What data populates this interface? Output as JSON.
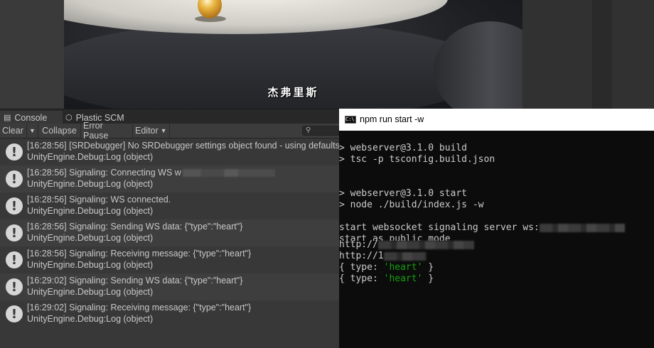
{
  "game_view": {
    "subtitle": "杰弗里斯"
  },
  "console": {
    "tabs": [
      {
        "label": "Console",
        "icon": "console-icon"
      },
      {
        "label": "Plastic SCM",
        "icon": "plastic-scm-icon"
      }
    ],
    "toolbar": {
      "clear_label": "Clear",
      "collapse_label": "Collapse",
      "error_pause_label": "Error Pause",
      "editor_label": "Editor"
    },
    "search": {
      "placeholder": ""
    },
    "logs": [
      {
        "message": "[16:28:56] [SRDebugger] No SRDebugger settings object found - using defaults",
        "source": "UnityEngine.Debug:Log (object)",
        "icon": "warning-icon"
      },
      {
        "message": "[16:28:56] Signaling: Connecting WS w",
        "source": "UnityEngine.Debug:Log (object)",
        "icon": "warning-icon",
        "redacted": true
      },
      {
        "message": "[16:28:56] Signaling: WS connected.",
        "source": "UnityEngine.Debug:Log (object)",
        "icon": "warning-icon"
      },
      {
        "message": "[16:28:56] Signaling: Sending WS data: {\"type\":\"heart\"}",
        "source": "UnityEngine.Debug:Log (object)",
        "icon": "warning-icon"
      },
      {
        "message": "[16:28:56] Signaling: Receiving message: {\"type\":\"heart\"}",
        "source": "UnityEngine.Debug:Log (object)",
        "icon": "warning-icon"
      },
      {
        "message": "[16:29:02] Signaling: Sending WS data: {\"type\":\"heart\"}",
        "source": "UnityEngine.Debug:Log (object)",
        "icon": "warning-icon"
      },
      {
        "message": "[16:29:02] Signaling: Receiving message: {\"type\":\"heart\"}",
        "source": "UnityEngine.Debug:Log (object)",
        "icon": "warning-icon"
      }
    ]
  },
  "terminal": {
    "title": "npm run start -w",
    "lines": {
      "build_cmd": "> webserver@3.1.0 build",
      "tsc_cmd": "> tsc -p tsconfig.build.json",
      "start_cmd": "> webserver@3.1.0 start",
      "node_cmd": "> node ./build/index.js -w",
      "ws_start": "start websocket signaling server ws:",
      "public_mode": "start as public mode",
      "http1": "http://",
      "http2": "http://1",
      "type_open": "{ type: ",
      "heart": "'heart'",
      "type_close": " }"
    },
    "colors": {
      "string": "#13a10e",
      "text": "#cccccc",
      "background": "#0c0c0c"
    }
  }
}
